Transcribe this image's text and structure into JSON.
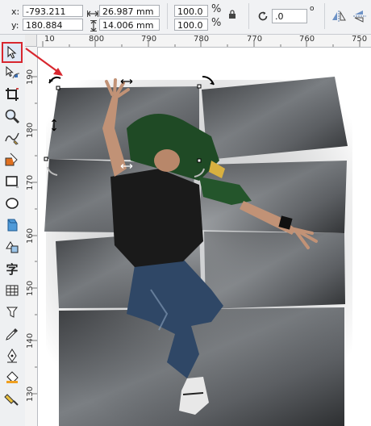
{
  "property_bar": {
    "x_label": "x:",
    "x_value": "-793.211 mm",
    "y_label": "y:",
    "y_value": "180.884 mm",
    "width_value": "26.987 mm",
    "height_value": "14.006 mm",
    "scale_x": "100.0",
    "scale_y": "100.0",
    "percent_symbol": "%",
    "rotation_value": ".0",
    "rotation_unit": "o"
  },
  "toolbox": {
    "tools": [
      {
        "name": "pick-tool",
        "icon": "arrow-pointer-icon",
        "selected": true
      },
      {
        "name": "shape-tool",
        "icon": "node-edit-icon"
      },
      {
        "name": "crop-tool",
        "icon": "crop-icon"
      },
      {
        "name": "zoom-tool",
        "icon": "magnifier-icon"
      },
      {
        "name": "freehand-tool",
        "icon": "freehand-icon"
      },
      {
        "name": "smart-fill-tool",
        "icon": "smart-fill-icon"
      },
      {
        "name": "rectangle-tool",
        "icon": "rectangle-icon"
      },
      {
        "name": "ellipse-tool",
        "icon": "ellipse-icon"
      },
      {
        "name": "polygon-tool",
        "icon": "polygon-icon"
      },
      {
        "name": "basic-shapes-tool",
        "icon": "basic-shapes-icon"
      },
      {
        "name": "text-tool",
        "icon": "text-tool-icon",
        "glyph": "字"
      },
      {
        "name": "table-tool",
        "icon": "table-icon"
      },
      {
        "name": "dimension-tool",
        "icon": "dimension-icon"
      },
      {
        "name": "eyedropper-tool",
        "icon": "eyedropper-icon"
      },
      {
        "name": "outline-pen-tool",
        "icon": "pen-nib-icon"
      },
      {
        "name": "fill-tool",
        "icon": "paint-bucket-icon"
      },
      {
        "name": "interactive-fill-tool",
        "icon": "interactive-fill-icon"
      }
    ]
  },
  "ruler": {
    "horizontal_ticks": [
      "10",
      "800",
      "790",
      "780",
      "770",
      "760",
      "750"
    ],
    "vertical_ticks": [
      "190",
      "180",
      "170",
      "160",
      "150",
      "140",
      "130"
    ]
  },
  "colors": {
    "selection_highlight": "#d8262e",
    "canvas": "#ffffff",
    "toolbar_bg": "#f1f2f4"
  }
}
